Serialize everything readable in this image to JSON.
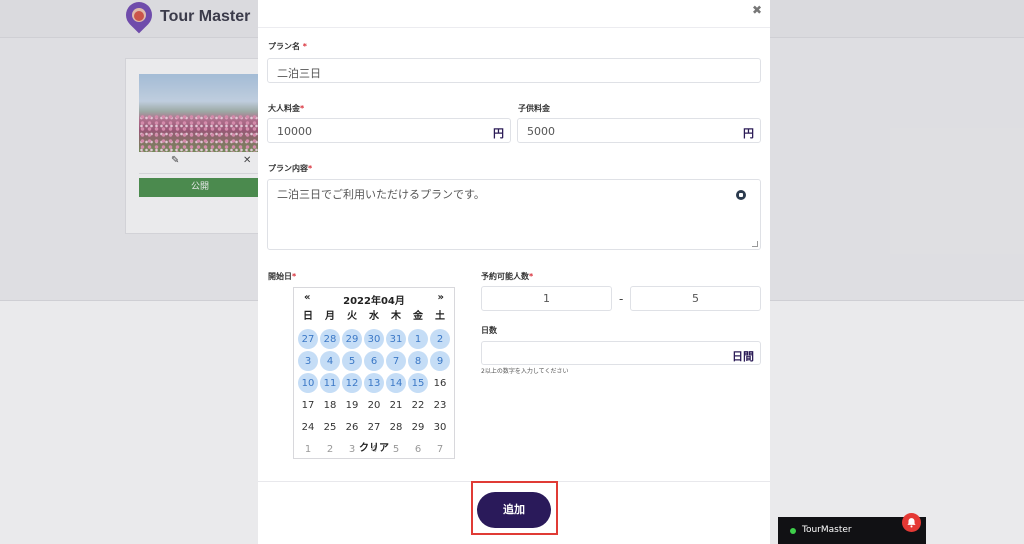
{
  "app": {
    "brand": "Tour Master"
  },
  "background": {
    "card": {
      "edit_icon": "pencil-icon",
      "delete_icon": "close-icon",
      "publish_label": "公開"
    }
  },
  "modal": {
    "close_icon": "close-icon",
    "plan_name": {
      "label": "プラン名",
      "required": "*",
      "value": "二泊三日"
    },
    "adult_price": {
      "label": "大人料金",
      "required": "*",
      "value": "10000",
      "unit": "円"
    },
    "child_price": {
      "label": "子供料金",
      "value": "5000",
      "unit": "円"
    },
    "plan_content": {
      "label": "プラン内容",
      "required": "*",
      "value": "二泊三日でご利用いただけるプランです。"
    },
    "start_date": {
      "label": "開始日",
      "required": "*"
    },
    "calendar": {
      "prev": "«",
      "next": "»",
      "title": "2022年04月",
      "weekdays": [
        "日",
        "月",
        "火",
        "水",
        "木",
        "金",
        "土"
      ],
      "weeks": [
        [
          "27",
          "28",
          "29",
          "30",
          "31",
          "1",
          "2"
        ],
        [
          "3",
          "4",
          "5",
          "6",
          "7",
          "8",
          "9"
        ],
        [
          "10",
          "11",
          "12",
          "13",
          "14",
          "15",
          "16"
        ],
        [
          "17",
          "18",
          "19",
          "20",
          "21",
          "22",
          "23"
        ],
        [
          "24",
          "25",
          "26",
          "27",
          "28",
          "29",
          "30"
        ],
        [
          "1",
          "2",
          "3",
          "4",
          "5",
          "6",
          "7"
        ]
      ],
      "clear": "クリア"
    },
    "capacity": {
      "label": "予約可能人数",
      "required": "*",
      "min": "1",
      "separator": "-",
      "max": "5"
    },
    "days": {
      "label": "日数",
      "value": "",
      "unit": "日間",
      "hint": "2以上の数字を入力してください"
    },
    "submit_label": "追加"
  },
  "chat": {
    "name": "TourMaster",
    "status_color": "#3ecf4a",
    "bell_icon": "bell-icon"
  }
}
